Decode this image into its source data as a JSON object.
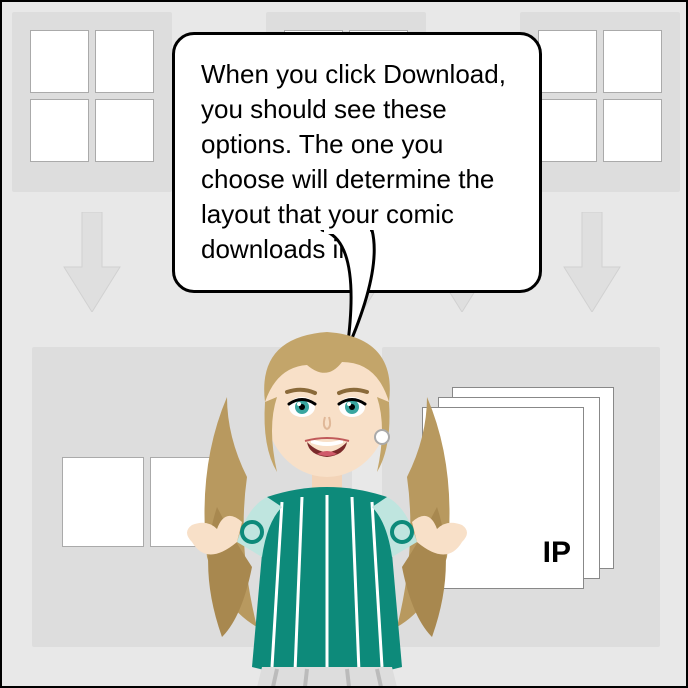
{
  "bubble": {
    "text": "When you click Download, you should see these options. The one you choose will determine the layout that your comic downloads in."
  },
  "bottom_right": {
    "zip_label": "IP"
  },
  "character": {
    "name": "avatar-woman",
    "shirt_color": "#0d8a7a",
    "hair_color": "#b8995f",
    "skin_color": "#f8e0c8",
    "eye_color": "#3aa6a0"
  }
}
